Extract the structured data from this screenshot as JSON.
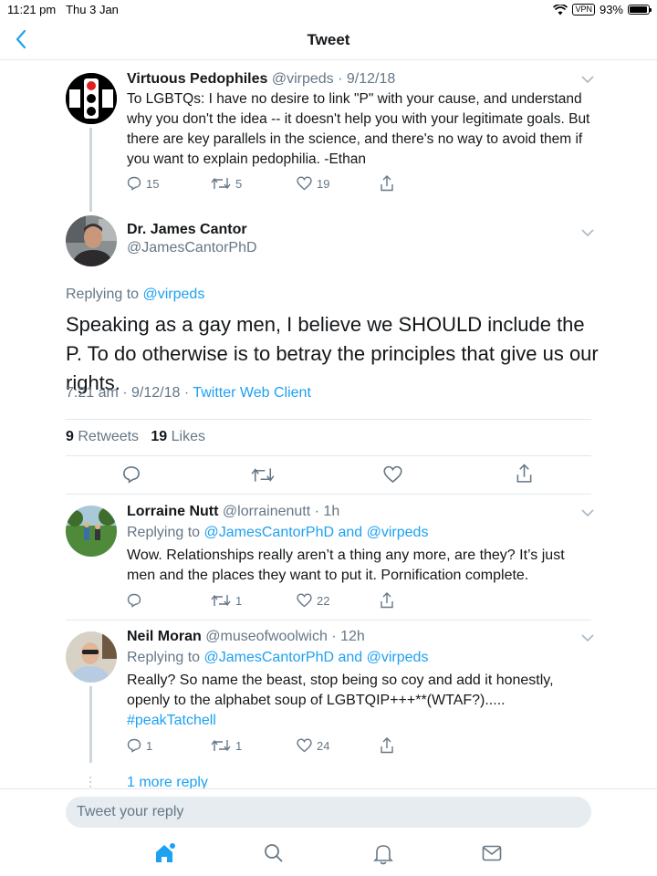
{
  "status": {
    "time": "11:21 pm",
    "date": "Thu 3 Jan",
    "vpn": "VPN",
    "battery": "93%",
    "battery_level": 0.93
  },
  "nav": {
    "title": "Tweet"
  },
  "parent": {
    "name": "Virtuous Pedophiles",
    "handle": "@virpeds",
    "date": "9/12/18",
    "text": "To LGBTQs: I have no desire to link \"P\" with your cause, and understand why you don't the idea -- it doesn't help you with your legitimate goals. But there are key parallels in the science, and there's no way to avoid them if you want to explain pedophilia.  -Ethan",
    "replies": "15",
    "retweets": "5",
    "likes": "19"
  },
  "main": {
    "name": "Dr. James Cantor",
    "handle": "@JamesCantorPhD",
    "replying_prefix": "Replying to",
    "replying_to": "@virpeds",
    "text": "Speaking as a gay men, I believe we SHOULD include the P.  To do otherwise is to betray the principles that give us our rights.",
    "time": "7:21 am",
    "date": "9/12/18",
    "client": "Twitter Web Client",
    "retweets_count": "9",
    "retweets_label": "Retweets",
    "likes_count": "19",
    "likes_label": "Likes"
  },
  "replies": [
    {
      "name": "Lorraine Nutt",
      "handle": "@lorrainenutt",
      "time": "1h",
      "replying_prefix": "Replying to",
      "to1": "@JamesCantorPhD",
      "and": "and",
      "to2": "@virpeds",
      "text": "Wow. Relationships really aren’t a thing any more, are they? It’s just men and the places they want to put it. Pornification complete.",
      "replies": "",
      "retweets": "1",
      "likes": "22"
    },
    {
      "name": "Neil Moran",
      "handle": "@museofwoolwich",
      "time": "12h",
      "replying_prefix": "Replying to",
      "to1": "@JamesCantorPhD",
      "and": "and",
      "to2": "@virpeds",
      "text": "Really? So name the beast, stop being so coy and add it honestly, openly to the alphabet soup of LGBTQIP+++**(WTAF?).....",
      "hashtag": "#peakTatchell",
      "replies": "1",
      "retweets": "1",
      "likes": "24"
    }
  ],
  "more_reply": "1 more reply",
  "reply_bar": {
    "placeholder": "Tweet your reply"
  },
  "colors": {
    "accent": "#1da1f2",
    "muted": "#657786",
    "separator": "#e1e8ed"
  },
  "icons": [
    "back-chevron-icon",
    "reply-icon",
    "retweet-icon",
    "like-icon",
    "share-icon",
    "chevron-down-icon",
    "home-icon",
    "search-icon",
    "notifications-icon",
    "messages-icon"
  ]
}
